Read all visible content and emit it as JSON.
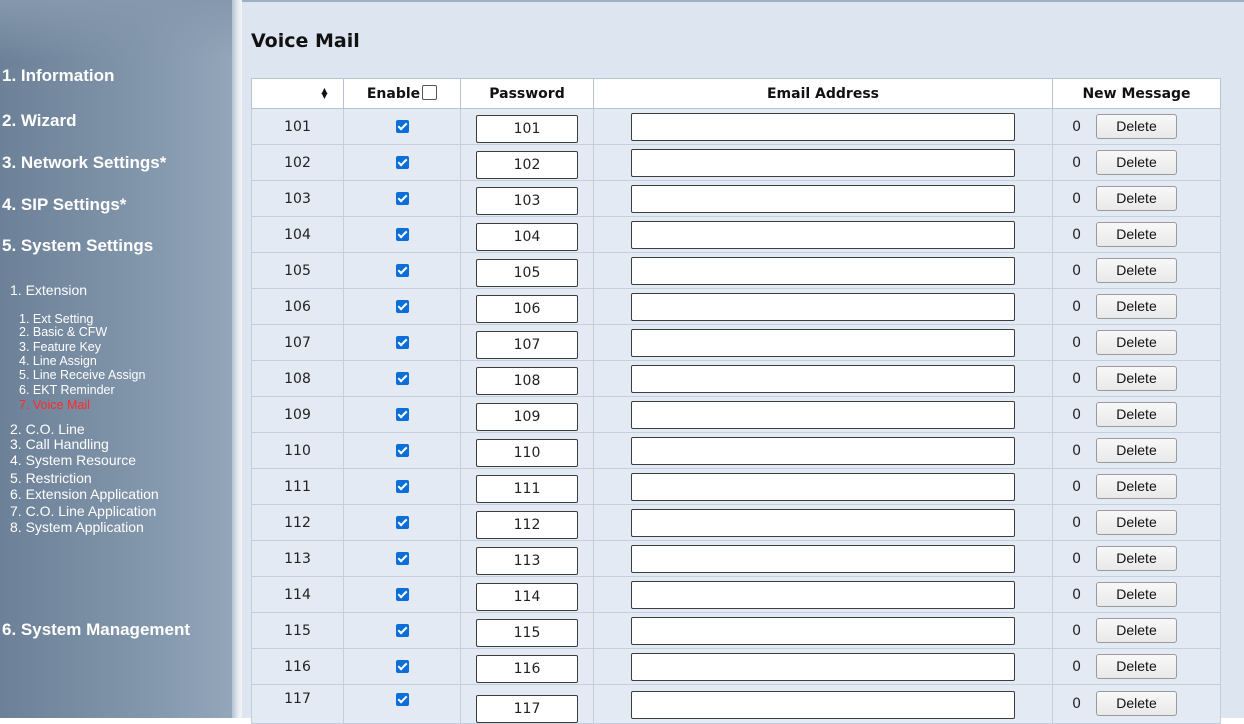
{
  "sidebar": {
    "main_items": [
      "1. Information",
      "2. Wizard",
      "3. Network Settings*",
      "4. SIP Settings*",
      "5. System Settings",
      "6. System Management"
    ],
    "extension_label": "1. Extension",
    "extension_items": [
      "1. Ext Setting",
      "2. Basic & CFW",
      "3. Feature Key",
      "4. Line Assign",
      "5. Line Receive Assign",
      "6. EKT Reminder",
      "7. Voice Mail"
    ],
    "system_items": [
      "2. C.O. Line",
      "3. Call Handling",
      "4. System Resource",
      "5. Restriction",
      "6. Extension Application",
      "7. C.O. Line Application",
      "8. System Application"
    ],
    "active_item": "7. Voice Mail",
    "active_color": "#ff2a2a"
  },
  "page": {
    "title": "Voice Mail"
  },
  "table": {
    "headers": {
      "sort_icon": "sort-updown-icon",
      "enable": "Enable",
      "password": "Password",
      "email": "Email Address",
      "new_message": "New Message"
    },
    "delete_label": "Delete",
    "checkbox_color": "#0b6ed9",
    "rows": [
      {
        "ext": "101",
        "enabled": true,
        "password": "101",
        "email": "",
        "new_messages": "0"
      },
      {
        "ext": "102",
        "enabled": true,
        "password": "102",
        "email": "",
        "new_messages": "0"
      },
      {
        "ext": "103",
        "enabled": true,
        "password": "103",
        "email": "",
        "new_messages": "0"
      },
      {
        "ext": "104",
        "enabled": true,
        "password": "104",
        "email": "",
        "new_messages": "0"
      },
      {
        "ext": "105",
        "enabled": true,
        "password": "105",
        "email": "",
        "new_messages": "0"
      },
      {
        "ext": "106",
        "enabled": true,
        "password": "106",
        "email": "",
        "new_messages": "0"
      },
      {
        "ext": "107",
        "enabled": true,
        "password": "107",
        "email": "",
        "new_messages": "0"
      },
      {
        "ext": "108",
        "enabled": true,
        "password": "108",
        "email": "",
        "new_messages": "0"
      },
      {
        "ext": "109",
        "enabled": true,
        "password": "109",
        "email": "",
        "new_messages": "0"
      },
      {
        "ext": "110",
        "enabled": true,
        "password": "110",
        "email": "",
        "new_messages": "0"
      },
      {
        "ext": "111",
        "enabled": true,
        "password": "111",
        "email": "",
        "new_messages": "0"
      },
      {
        "ext": "112",
        "enabled": true,
        "password": "112",
        "email": "",
        "new_messages": "0"
      },
      {
        "ext": "113",
        "enabled": true,
        "password": "113",
        "email": "",
        "new_messages": "0"
      },
      {
        "ext": "114",
        "enabled": true,
        "password": "114",
        "email": "",
        "new_messages": "0"
      },
      {
        "ext": "115",
        "enabled": true,
        "password": "115",
        "email": "",
        "new_messages": "0"
      },
      {
        "ext": "116",
        "enabled": true,
        "password": "116",
        "email": "",
        "new_messages": "0"
      },
      {
        "ext": "117",
        "enabled": true,
        "password": "117",
        "email": "",
        "new_messages": "0"
      }
    ]
  }
}
